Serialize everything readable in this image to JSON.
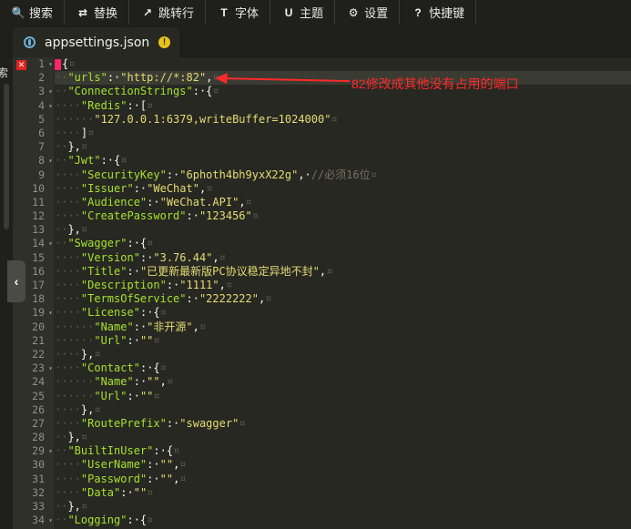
{
  "toolbar": {
    "buttons": [
      {
        "label": "搜索",
        "icon": "search-icon",
        "glyph": "🔍"
      },
      {
        "label": "替换",
        "icon": "replace-icon",
        "glyph": "⇄"
      },
      {
        "label": "跳转行",
        "icon": "goto-line-icon",
        "glyph": "↗"
      },
      {
        "label": "字体",
        "icon": "font-icon",
        "glyph": "T"
      },
      {
        "label": "主题",
        "icon": "theme-icon",
        "glyph": "U"
      },
      {
        "label": "设置",
        "icon": "gear-icon",
        "glyph": "⚙"
      },
      {
        "label": "快捷键",
        "icon": "help-icon",
        "glyph": "?"
      }
    ]
  },
  "tab": {
    "filename": "appsettings.json",
    "warning_glyph": "!"
  },
  "left_strip": {
    "fragment": "索"
  },
  "collapse_handle": {
    "glyph": "‹"
  },
  "annotation": {
    "text": "82修改成其他没有占用的端口",
    "color": "#ff2a2a"
  },
  "error_marker": {
    "glyph": "✕"
  },
  "code_lines": [
    {
      "n": "1",
      "fold": true,
      "segs": [
        [
          "p",
          "{"
        ]
      ]
    },
    {
      "n": "2",
      "fold": false,
      "segs": [
        [
          "ws",
          "··"
        ],
        [
          "k",
          "\"urls\""
        ],
        [
          "p",
          ":·"
        ],
        [
          "s",
          "\"http://*:82\""
        ],
        [
          "p",
          ","
        ]
      ]
    },
    {
      "n": "3",
      "fold": true,
      "segs": [
        [
          "ws",
          "··"
        ],
        [
          "k",
          "\"ConnectionStrings\""
        ],
        [
          "p",
          ":·{"
        ]
      ]
    },
    {
      "n": "4",
      "fold": true,
      "segs": [
        [
          "ws",
          "····"
        ],
        [
          "k",
          "\"Redis\""
        ],
        [
          "p",
          ":·["
        ]
      ]
    },
    {
      "n": "5",
      "fold": false,
      "segs": [
        [
          "ws",
          "······"
        ],
        [
          "s",
          "\"127.0.0.1:6379,writeBuffer=1024000\""
        ]
      ]
    },
    {
      "n": "6",
      "fold": false,
      "segs": [
        [
          "ws",
          "····"
        ],
        [
          "p",
          "]"
        ]
      ]
    },
    {
      "n": "7",
      "fold": false,
      "segs": [
        [
          "ws",
          "··"
        ],
        [
          "p",
          "},"
        ]
      ]
    },
    {
      "n": "8",
      "fold": true,
      "segs": [
        [
          "ws",
          "··"
        ],
        [
          "k",
          "\"Jwt\""
        ],
        [
          "p",
          ":·{"
        ]
      ]
    },
    {
      "n": "9",
      "fold": false,
      "segs": [
        [
          "ws",
          "····"
        ],
        [
          "k",
          "\"SecurityKey\""
        ],
        [
          "p",
          ":·"
        ],
        [
          "s",
          "\"6photh4bh9yxX22g\""
        ],
        [
          "p",
          ",·"
        ],
        [
          "c",
          "//必须16位"
        ]
      ]
    },
    {
      "n": "10",
      "fold": false,
      "segs": [
        [
          "ws",
          "····"
        ],
        [
          "k",
          "\"Issuer\""
        ],
        [
          "p",
          ":·"
        ],
        [
          "s",
          "\"WeChat\""
        ],
        [
          "p",
          ","
        ]
      ]
    },
    {
      "n": "11",
      "fold": false,
      "segs": [
        [
          "ws",
          "····"
        ],
        [
          "k",
          "\"Audience\""
        ],
        [
          "p",
          ":·"
        ],
        [
          "s",
          "\"WeChat.API\""
        ],
        [
          "p",
          ","
        ]
      ]
    },
    {
      "n": "12",
      "fold": false,
      "segs": [
        [
          "ws",
          "····"
        ],
        [
          "k",
          "\"CreatePassword\""
        ],
        [
          "p",
          ":·"
        ],
        [
          "s",
          "\"123456\""
        ]
      ]
    },
    {
      "n": "13",
      "fold": false,
      "segs": [
        [
          "ws",
          "··"
        ],
        [
          "p",
          "},"
        ]
      ]
    },
    {
      "n": "14",
      "fold": true,
      "segs": [
        [
          "ws",
          "··"
        ],
        [
          "k",
          "\"Swagger\""
        ],
        [
          "p",
          ":·{"
        ]
      ]
    },
    {
      "n": "15",
      "fold": false,
      "segs": [
        [
          "ws",
          "····"
        ],
        [
          "k",
          "\"Version\""
        ],
        [
          "p",
          ":·"
        ],
        [
          "s",
          "\"3.76.44\""
        ],
        [
          "p",
          ","
        ]
      ]
    },
    {
      "n": "16",
      "fold": false,
      "segs": [
        [
          "ws",
          "····"
        ],
        [
          "k",
          "\"Title\""
        ],
        [
          "p",
          ":·"
        ],
        [
          "s",
          "\"已更新最新版PC协议稳定异地不封\""
        ],
        [
          "p",
          ","
        ]
      ]
    },
    {
      "n": "17",
      "fold": false,
      "segs": [
        [
          "ws",
          "····"
        ],
        [
          "k",
          "\"Description\""
        ],
        [
          "p",
          ":·"
        ],
        [
          "s",
          "\"1111\""
        ],
        [
          "p",
          ","
        ]
      ]
    },
    {
      "n": "18",
      "fold": false,
      "segs": [
        [
          "ws",
          "····"
        ],
        [
          "k",
          "\"TermsOfService\""
        ],
        [
          "p",
          ":·"
        ],
        [
          "s",
          "\"2222222\""
        ],
        [
          "p",
          ","
        ]
      ]
    },
    {
      "n": "19",
      "fold": true,
      "segs": [
        [
          "ws",
          "····"
        ],
        [
          "k",
          "\"License\""
        ],
        [
          "p",
          ":·{"
        ]
      ]
    },
    {
      "n": "20",
      "fold": false,
      "segs": [
        [
          "ws",
          "······"
        ],
        [
          "k",
          "\"Name\""
        ],
        [
          "p",
          ":·"
        ],
        [
          "s",
          "\"非开源\""
        ],
        [
          "p",
          ","
        ]
      ]
    },
    {
      "n": "21",
      "fold": false,
      "segs": [
        [
          "ws",
          "······"
        ],
        [
          "k",
          "\"Url\""
        ],
        [
          "p",
          ":·"
        ],
        [
          "s",
          "\"\""
        ]
      ]
    },
    {
      "n": "22",
      "fold": false,
      "segs": [
        [
          "ws",
          "····"
        ],
        [
          "p",
          "},"
        ]
      ]
    },
    {
      "n": "23",
      "fold": true,
      "segs": [
        [
          "ws",
          "····"
        ],
        [
          "k",
          "\"Contact\""
        ],
        [
          "p",
          ":·{"
        ]
      ]
    },
    {
      "n": "24",
      "fold": false,
      "segs": [
        [
          "ws",
          "······"
        ],
        [
          "k",
          "\"Name\""
        ],
        [
          "p",
          ":·"
        ],
        [
          "s",
          "\"\""
        ],
        [
          "p",
          ","
        ]
      ]
    },
    {
      "n": "25",
      "fold": false,
      "segs": [
        [
          "ws",
          "······"
        ],
        [
          "k",
          "\"Url\""
        ],
        [
          "p",
          ":·"
        ],
        [
          "s",
          "\"\""
        ]
      ]
    },
    {
      "n": "26",
      "fold": false,
      "segs": [
        [
          "ws",
          "····"
        ],
        [
          "p",
          "},"
        ]
      ]
    },
    {
      "n": "27",
      "fold": false,
      "segs": [
        [
          "ws",
          "····"
        ],
        [
          "k",
          "\"RoutePrefix\""
        ],
        [
          "p",
          ":·"
        ],
        [
          "s",
          "\"swagger\""
        ]
      ]
    },
    {
      "n": "28",
      "fold": false,
      "segs": [
        [
          "ws",
          "··"
        ],
        [
          "p",
          "},"
        ]
      ]
    },
    {
      "n": "29",
      "fold": true,
      "segs": [
        [
          "ws",
          "··"
        ],
        [
          "k",
          "\"BuiltInUser\""
        ],
        [
          "p",
          ":·{"
        ]
      ]
    },
    {
      "n": "30",
      "fold": false,
      "segs": [
        [
          "ws",
          "····"
        ],
        [
          "k",
          "\"UserName\""
        ],
        [
          "p",
          ":·"
        ],
        [
          "s",
          "\"\""
        ],
        [
          "p",
          ","
        ]
      ]
    },
    {
      "n": "31",
      "fold": false,
      "segs": [
        [
          "ws",
          "····"
        ],
        [
          "k",
          "\"Password\""
        ],
        [
          "p",
          ":·"
        ],
        [
          "s",
          "\"\""
        ],
        [
          "p",
          ","
        ]
      ]
    },
    {
      "n": "32",
      "fold": false,
      "segs": [
        [
          "ws",
          "····"
        ],
        [
          "k",
          "\"Data\""
        ],
        [
          "p",
          ":·"
        ],
        [
          "s",
          "\"\""
        ]
      ]
    },
    {
      "n": "33",
      "fold": false,
      "segs": [
        [
          "ws",
          "··"
        ],
        [
          "p",
          "},"
        ]
      ]
    },
    {
      "n": "34",
      "fold": true,
      "segs": [
        [
          "ws",
          "··"
        ],
        [
          "k",
          "\"Logging\""
        ],
        [
          "p",
          ":·{"
        ]
      ]
    }
  ]
}
